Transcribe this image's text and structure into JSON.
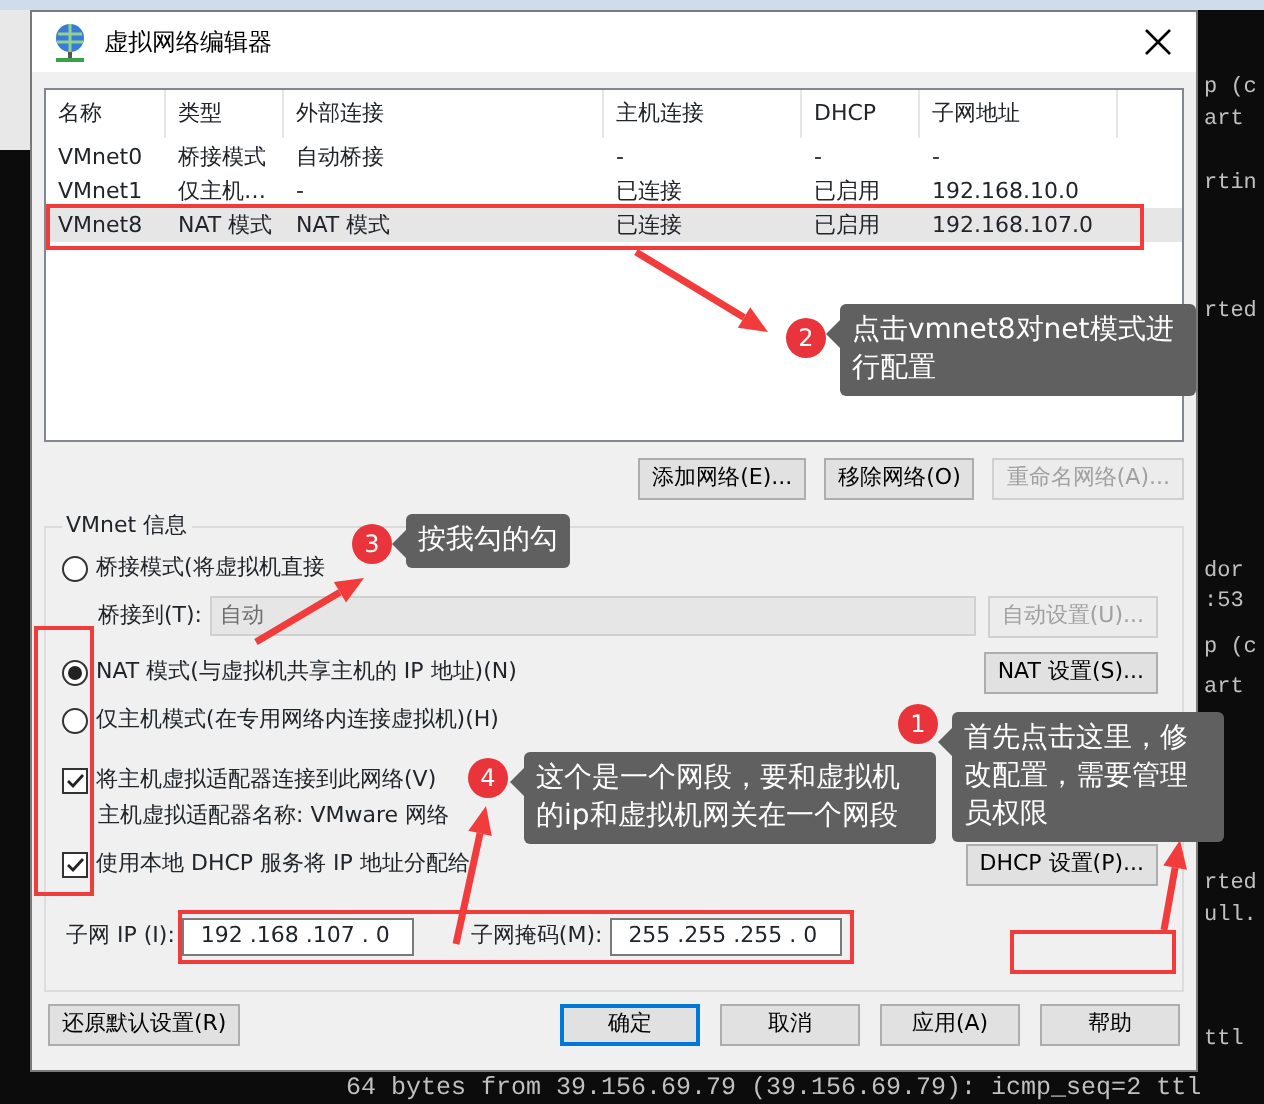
{
  "window": {
    "title": "虚拟网络编辑器"
  },
  "network_table": {
    "columns": [
      "名称",
      "类型",
      "外部连接",
      "主机连接",
      "DHCP",
      "子网地址"
    ],
    "rows": [
      {
        "cells": [
          "VMnet0",
          "桥接模式",
          "自动桥接",
          "-",
          "-",
          "-"
        ],
        "selected": false
      },
      {
        "cells": [
          "VMnet1",
          "仅主机…",
          "-",
          "已连接",
          "已启用",
          "192.168.10.0"
        ],
        "selected": false
      },
      {
        "cells": [
          "VMnet8",
          "NAT 模式",
          "NAT 模式",
          "已连接",
          "已启用",
          "192.168.107.0"
        ],
        "selected": true
      }
    ]
  },
  "table_buttons": [
    {
      "label": "添加网络(E)...",
      "disabled": false
    },
    {
      "label": "移除网络(O)",
      "disabled": false
    },
    {
      "label": "重命名网络(A)...",
      "disabled": true
    }
  ],
  "vmnet_info": {
    "title": "VMnet 信息",
    "modes": [
      {
        "label": "桥接模式(将虚拟机直接",
        "selected": false
      },
      {
        "label": "NAT 模式(与虚拟机共享主机的 IP 地址)(N)",
        "selected": true
      },
      {
        "label": "仅主机模式(在专用网络内连接虚拟机)(H)",
        "selected": false
      }
    ],
    "bridge_to": {
      "label": "桥接到(T):",
      "value": "自动",
      "disabled": true
    },
    "auto_settings_button": {
      "label": "自动设置(U)...",
      "disabled": true
    },
    "nat_settings_button": {
      "label": "NAT 设置(S)...",
      "disabled": false
    },
    "connect_adapter": {
      "label": "将主机虚拟适配器连接到此网络(V)",
      "checked": true
    },
    "adapter_name": "主机虚拟适配器名称: VMware 网络",
    "use_dhcp": {
      "label": "使用本地 DHCP 服务将 IP 地址分配给",
      "checked": true
    },
    "dhcp_settings_button": {
      "label": "DHCP 设置(P)...",
      "disabled": false
    },
    "subnet_ip": {
      "label": "子网 IP (I):",
      "value": "192 .168 .107 . 0"
    },
    "subnet_mask": {
      "label": "子网掩码(M):",
      "value": "255 .255 .255 . 0"
    }
  },
  "footer_buttons": [
    {
      "label": "还原默认设置(R)",
      "default": false
    },
    {
      "label": "确定",
      "default": true
    },
    {
      "label": "取消",
      "default": false
    },
    {
      "label": "应用(A)",
      "default": false
    },
    {
      "label": "帮助",
      "default": false
    }
  ],
  "annotations": [
    {
      "number": "2",
      "text": "点击vmnet8对net模式进行配置"
    },
    {
      "number": "3",
      "text": "按我勾的勾"
    },
    {
      "number": "4",
      "text": "这个是一个网段，要和虚拟机的ip和虚拟机网关在一个网段"
    },
    {
      "number": "1",
      "text": "首先点击这里，修改配置，需要管理员权限"
    }
  ],
  "terminal": {
    "side_lines": [
      "p (c",
      "art",
      "rtin",
      "rted",
      "dor",
      ":53",
      "p (c",
      "art",
      "rted",
      "ull.",
      "ttl"
    ],
    "bottom_line": "64 bytes from 39.156.69.79 (39.156.69.79): icmp_seq=2 ttl"
  }
}
